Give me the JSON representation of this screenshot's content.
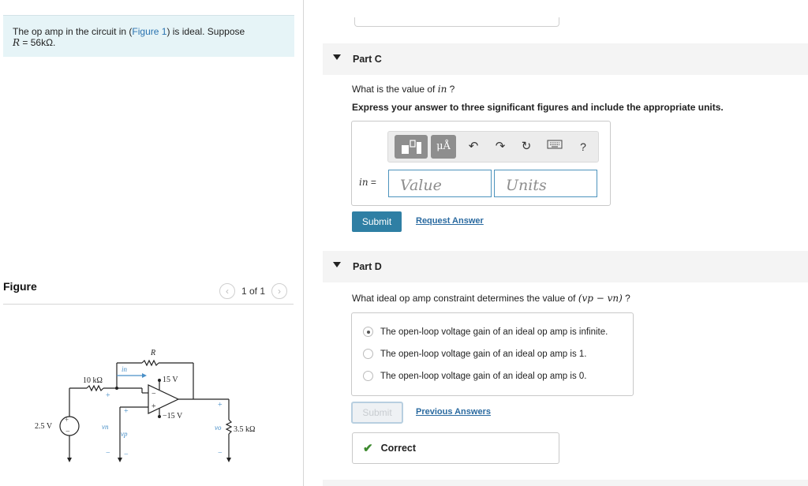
{
  "problem": {
    "text_before_link": "The op amp in the circuit in (",
    "link": "Figure 1",
    "text_after_link": ") is ideal. Suppose",
    "given_var": "R",
    "given_value": " = 56kΩ."
  },
  "figure": {
    "title": "Figure",
    "page": "1 of 1",
    "prev_icon": "chevron-left",
    "next_icon": "chevron-right",
    "labels": {
      "r_top": "R",
      "r_left": "10 kΩ",
      "v_pos": "15 V",
      "v_neg": "−15 V",
      "source": "2.5 V",
      "r_load": "3.5 kΩ",
      "i_n": "in",
      "v_n": "vn",
      "v_p": "vp",
      "v_o": "vo"
    }
  },
  "part_c": {
    "title": "Part C",
    "question_prefix": "What is the value of ",
    "question_var": "in",
    "question_suffix": " ?",
    "instruction": "Express your answer to three significant figures and include the appropriate units.",
    "toolbar": {
      "units_button": "μÅ",
      "help": "?"
    },
    "eq_var": "in",
    "eq_sign": " =",
    "value_placeholder": "Value",
    "units_placeholder": "Units",
    "submit": "Submit",
    "request": "Request Answer"
  },
  "part_d": {
    "title": "Part D",
    "question_prefix": "What ideal op amp constraint determines the value of ",
    "question_expr": "(vp − vn)",
    "question_suffix": " ?",
    "options": [
      {
        "label": "The open-loop voltage gain of an ideal op amp is infinite.",
        "selected": true
      },
      {
        "label": "The open-loop voltage gain of an ideal op amp is 1.",
        "selected": false
      },
      {
        "label": "The open-loop voltage gain of an ideal op amp is 0.",
        "selected": false
      }
    ],
    "submit": "Submit",
    "previous": "Previous Answers",
    "feedback": "Correct"
  },
  "colors": {
    "accent": "#2f7fa4",
    "link": "#2a73b0",
    "problem_bg": "#e6f4f7",
    "success": "#3d8a2f",
    "circuit_blue": "#4a90c8"
  }
}
